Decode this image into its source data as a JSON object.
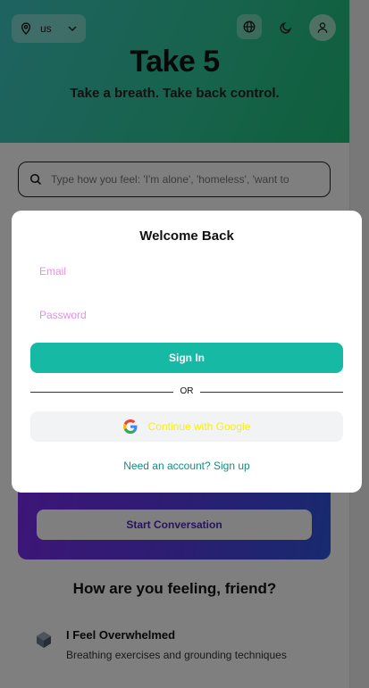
{
  "header": {
    "region_code": "us",
    "title": "Take 5",
    "subtitle": "Take a breath. Take back control."
  },
  "search": {
    "placeholder": "Type how you feel: 'I'm alone', 'homeless', 'want to"
  },
  "conversation_card": {
    "button_label": "Start Conversation"
  },
  "feelings": {
    "section_title": "How are you feeling, friend?",
    "items": [
      {
        "title": "I Feel Overwhelmed",
        "description": "Breathing exercises and grounding techniques"
      }
    ]
  },
  "login_modal": {
    "title": "Welcome Back",
    "email_placeholder": "Email",
    "password_placeholder": "Password",
    "signin_label": "Sign In",
    "divider_label": "OR",
    "google_label": "Continue with Google",
    "signup_label": "Need an account? Sign up"
  },
  "colors": {
    "accent": "#16b9a3",
    "placeholder_pink": "#e98be9",
    "google_text": "#f7ee12",
    "link": "#138d7f"
  },
  "icons": [
    "map-pin-icon",
    "chevron-down-icon",
    "globe-icon",
    "moon-icon",
    "user-icon",
    "search-icon",
    "google-icon",
    "cube-icon"
  ]
}
